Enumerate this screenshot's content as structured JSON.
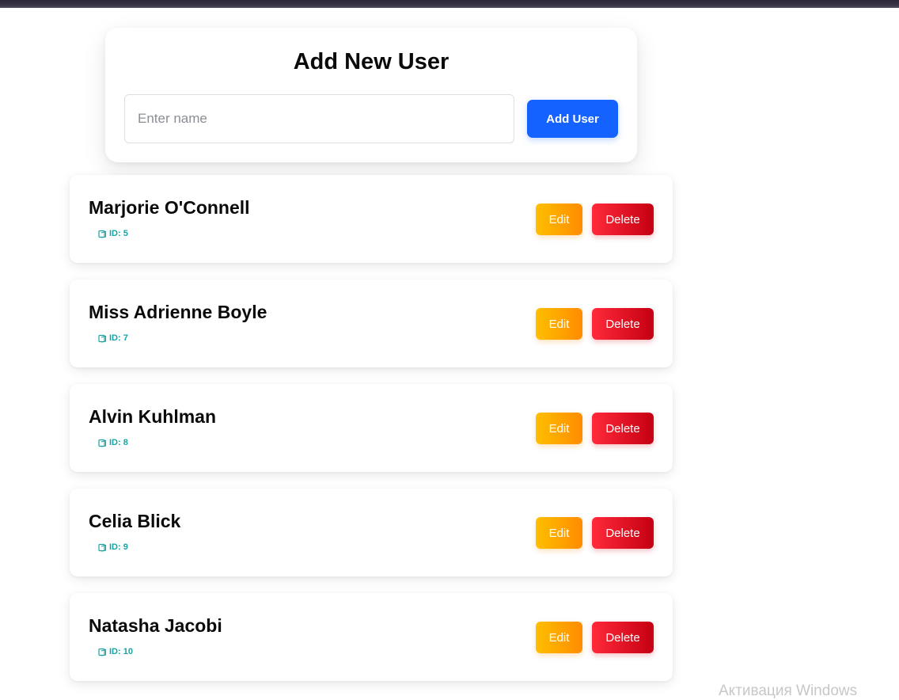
{
  "add_form": {
    "title": "Add New User",
    "input_placeholder": "Enter name",
    "input_value": "",
    "button_label": "Add User"
  },
  "users": [
    {
      "name": "Marjorie O'Connell",
      "id_label": "ID: 5",
      "edit_label": "Edit",
      "delete_label": "Delete"
    },
    {
      "name": "Miss Adrienne Boyle",
      "id_label": "ID: 7",
      "edit_label": "Edit",
      "delete_label": "Delete"
    },
    {
      "name": "Alvin Kuhlman",
      "id_label": "ID: 8",
      "edit_label": "Edit",
      "delete_label": "Delete"
    },
    {
      "name": "Celia Blick",
      "id_label": "ID: 9",
      "edit_label": "Edit",
      "delete_label": "Delete"
    },
    {
      "name": "Natasha Jacobi",
      "id_label": "ID: 10",
      "edit_label": "Edit",
      "delete_label": "Delete"
    }
  ],
  "icons": {
    "id_icon": "id-card-icon"
  },
  "colors": {
    "primary": "#1462ff",
    "edit_start": "#ffbf00",
    "edit_end": "#ff8c00",
    "delete_start": "#ff2a3a",
    "delete_end": "#c40012",
    "id_text": "#17a3a3"
  },
  "os_watermark": "Активация Windows"
}
